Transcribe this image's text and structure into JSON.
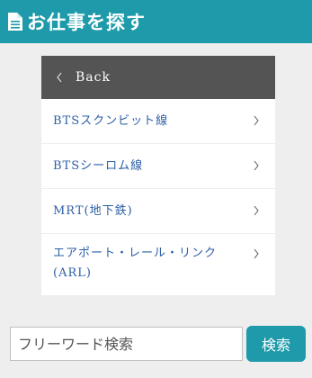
{
  "header": {
    "title": "お仕事を探す",
    "icon": "document-icon"
  },
  "nav": {
    "back_label": "Back",
    "items": [
      {
        "label": "BTSスクンビット線"
      },
      {
        "label": "BTSシーロム線"
      },
      {
        "label": "MRT(地下鉄)"
      },
      {
        "label": "エアポート・レール・リンク(ARL)"
      }
    ]
  },
  "search": {
    "placeholder": "フリーワード検索",
    "value": "",
    "button_label": "検索"
  },
  "colors": {
    "accent": "#1e9aaa",
    "back_bar": "#545454",
    "link": "#2b5fa5",
    "background": "#eeeeee"
  }
}
